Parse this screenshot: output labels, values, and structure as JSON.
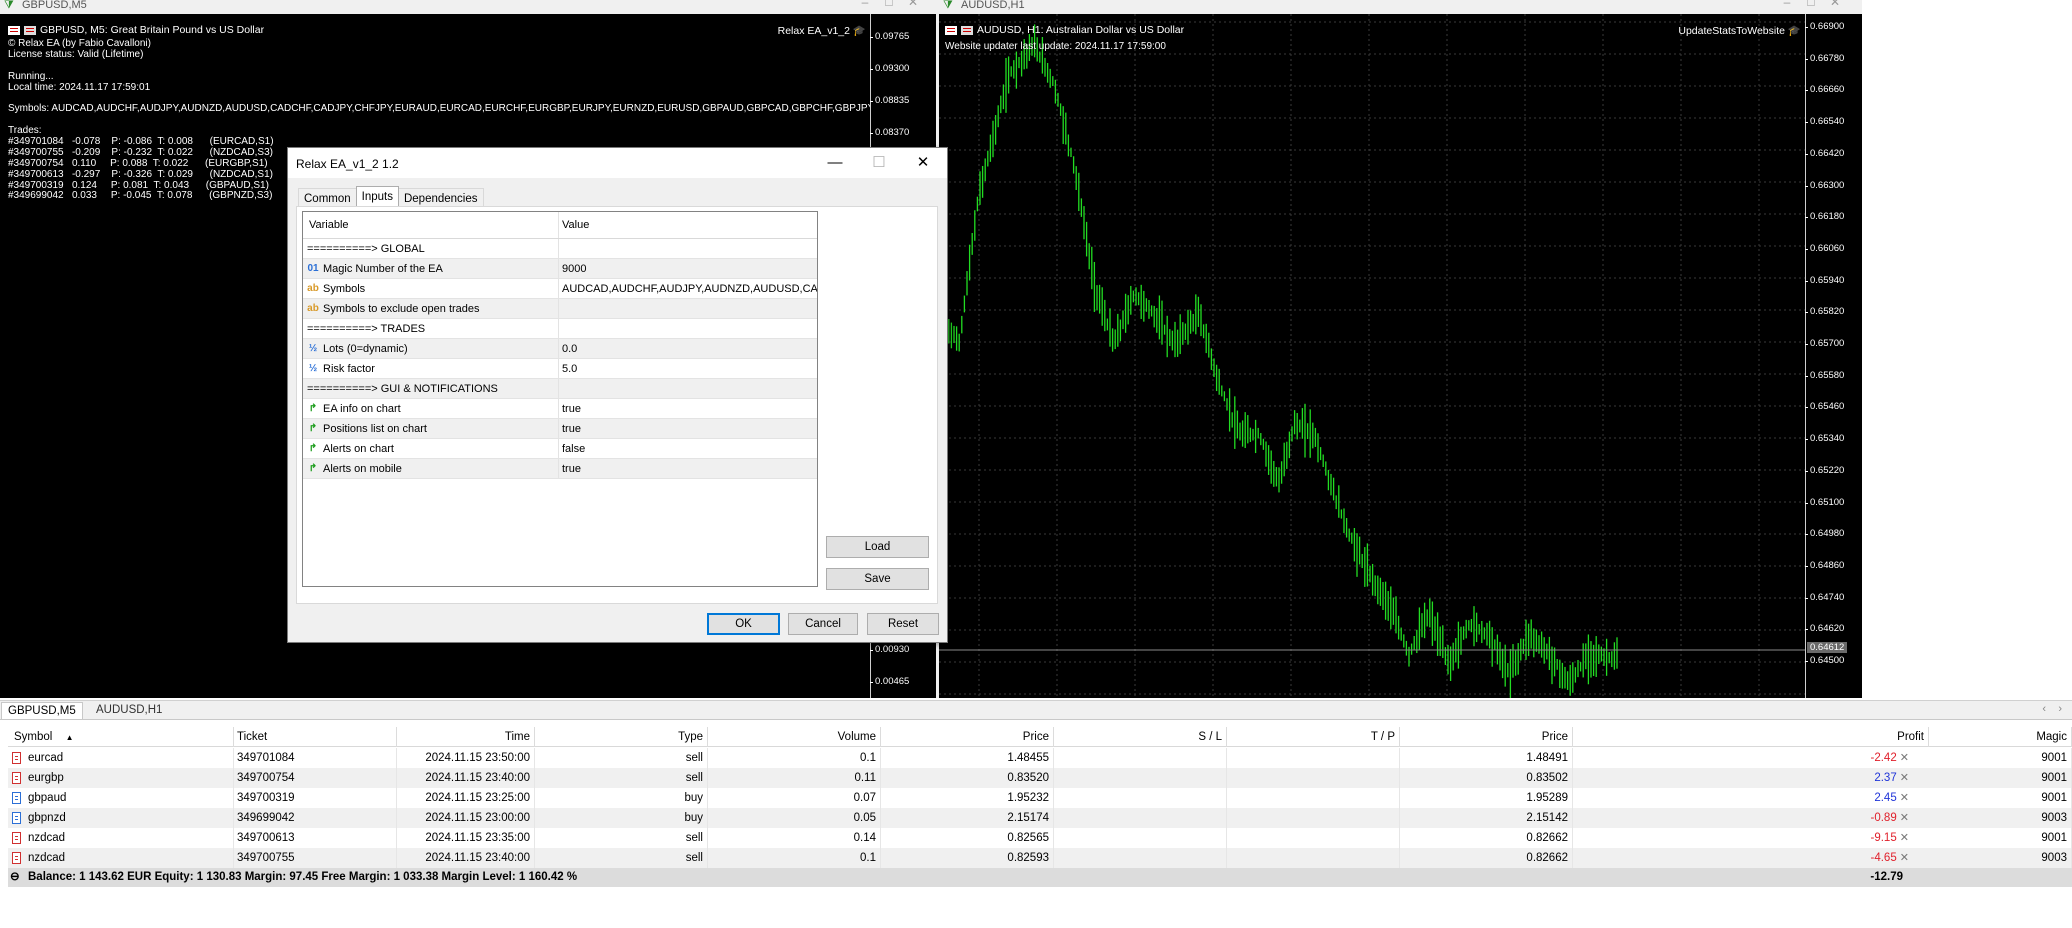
{
  "left_window": {
    "title": "GBPUSD,M5",
    "chart_header": "GBPUSD, M5:  Great Britain Pound vs US Dollar",
    "ea_label": "Relax EA_v1_2",
    "info_lines": [
      "© Relax EA (by Fabio Cavalloni)",
      "License status: Valid (Lifetime)",
      "",
      "Running...",
      "Local time: 2024.11.17 17:59:01",
      "",
      "Symbols: AUDCAD,AUDCHF,AUDJPY,AUDNZD,AUDUSD,CADCHF,CADJPY,CHFJPY,EURAUD,EURCAD,EURCHF,EURGBP,EURJPY,EURNZD,EURUSD,GBPAUD,GBPCAD,GBPCHF,GBPJPY,GBPN",
      "",
      "Trades:",
      "#349701084   -0.078    P: -0.086  T: 0.008      (EURCAD,S1)",
      "#349700755   -0.209    P: -0.232  T: 0.022      (NZDCAD,S3)",
      "#349700754   0.110     P: 0.088  T: 0.022      (EURGBP,S1)",
      "#349700613   -0.297    P: -0.326  T: 0.029      (NZDCAD,S1)",
      "#349700319   0.124     P: 0.081  T: 0.043      (GBPAUD,S1)",
      "#349699042   0.033     P: -0.045  T: 0.078      (GBPNZD,S3)"
    ],
    "price_ticks": [
      "0.09765",
      "0.09300",
      "0.08835",
      "0.08370",
      "0.00930",
      "0.00465"
    ]
  },
  "right_window": {
    "title": "AUDUSD,H1",
    "chart_header": "AUDUSD, H1:  Australian Dollar vs US Dollar",
    "ea_label": "UpdateStatsToWebsite",
    "info_line": "Website updater last update: 2024.11.17 17:59:00",
    "price_ticks": [
      "0.66900",
      "0.66780",
      "0.66660",
      "0.66540",
      "0.66420",
      "0.66300",
      "0.66180",
      "0.66060",
      "0.65940",
      "0.65820",
      "0.65700",
      "0.65580",
      "0.65460",
      "0.65340",
      "0.65220",
      "0.65100",
      "0.64980",
      "0.64860",
      "0.64740",
      "0.64620",
      "0.64500"
    ],
    "current_price": "0.64612"
  },
  "dialog": {
    "title": "Relax EA_v1_2 1.2",
    "tabs": [
      "Common",
      "Inputs",
      "Dependencies"
    ],
    "active_tab": "Inputs",
    "col_variable": "Variable",
    "col_value": "Value",
    "rows": [
      {
        "type": "section",
        "variable": "==========> GLOBAL",
        "value": ""
      },
      {
        "type": "int",
        "icon": "01",
        "variable": "Magic Number of the EA",
        "value": "9000"
      },
      {
        "type": "string",
        "icon": "ab",
        "variable": "Symbols",
        "value": "AUDCAD,AUDCHF,AUDJPY,AUDNZD,AUDUSD,CA..."
      },
      {
        "type": "string",
        "icon": "ab",
        "variable": "Symbols to exclude open trades",
        "value": ""
      },
      {
        "type": "section",
        "variable": "==========> TRADES",
        "value": ""
      },
      {
        "type": "double",
        "icon": "½",
        "variable": "Lots (0=dynamic)",
        "value": "0.0"
      },
      {
        "type": "double",
        "icon": "½",
        "variable": "Risk factor",
        "value": "5.0"
      },
      {
        "type": "section",
        "variable": "==========> GUI & NOTIFICATIONS",
        "value": ""
      },
      {
        "type": "bool",
        "icon": "↱",
        "variable": "EA info on chart",
        "value": "true"
      },
      {
        "type": "bool",
        "icon": "↱",
        "variable": "Positions list on chart",
        "value": "true"
      },
      {
        "type": "bool",
        "icon": "↱",
        "variable": "Alerts on chart",
        "value": "false"
      },
      {
        "type": "bool",
        "icon": "↱",
        "variable": "Alerts on mobile",
        "value": "true"
      }
    ],
    "load_label": "Load",
    "save_label": "Save",
    "ok_label": "OK",
    "cancel_label": "Cancel",
    "reset_label": "Reset"
  },
  "terminal": {
    "tabs": [
      "GBPUSD,M5",
      "AUDUSD,H1"
    ],
    "columns": [
      "Symbol",
      "Ticket",
      "Time",
      "Type",
      "Volume",
      "Price",
      "S / L",
      "T / P",
      "Price",
      "Profit",
      "Magic"
    ],
    "rows": [
      {
        "symbol": "eurcad",
        "ticket": "349701084",
        "time": "2024.11.15 23:50:00",
        "type": "sell",
        "volume": "0.1",
        "price": "1.48455",
        "sl": "",
        "tp": "",
        "cur": "1.48491",
        "profit": "-2.42",
        "magic": "9001"
      },
      {
        "symbol": "eurgbp",
        "ticket": "349700754",
        "time": "2024.11.15 23:40:00",
        "type": "sell",
        "volume": "0.11",
        "price": "0.83520",
        "sl": "",
        "tp": "",
        "cur": "0.83502",
        "profit": "2.37",
        "magic": "9001"
      },
      {
        "symbol": "gbpaud",
        "ticket": "349700319",
        "time": "2024.11.15 23:25:00",
        "type": "buy",
        "volume": "0.07",
        "price": "1.95232",
        "sl": "",
        "tp": "",
        "cur": "1.95289",
        "profit": "2.45",
        "magic": "9001"
      },
      {
        "symbol": "gbpnzd",
        "ticket": "349699042",
        "time": "2024.11.15 23:00:00",
        "type": "buy",
        "volume": "0.05",
        "price": "2.15174",
        "sl": "",
        "tp": "",
        "cur": "2.15142",
        "profit": "-0.89",
        "magic": "9003"
      },
      {
        "symbol": "nzdcad",
        "ticket": "349700613",
        "time": "2024.11.15 23:35:00",
        "type": "sell",
        "volume": "0.14",
        "price": "0.82565",
        "sl": "",
        "tp": "",
        "cur": "0.82662",
        "profit": "-9.15",
        "magic": "9001"
      },
      {
        "symbol": "nzdcad",
        "ticket": "349700755",
        "time": "2024.11.15 23:40:00",
        "type": "sell",
        "volume": "0.1",
        "price": "0.82593",
        "sl": "",
        "tp": "",
        "cur": "0.82662",
        "profit": "-4.65",
        "magic": "9003"
      }
    ],
    "balance_text": "Balance: 1 143.62 EUR  Equity: 1 130.83  Margin: 97.45  Free Margin: 1 033.38  Margin Level: 1 160.42 %",
    "total_profit": "-12.79"
  },
  "colors": {
    "candle": "#22dd22",
    "loss": "#e0202b",
    "gain": "#2035d8",
    "focus": "#0078d7"
  }
}
